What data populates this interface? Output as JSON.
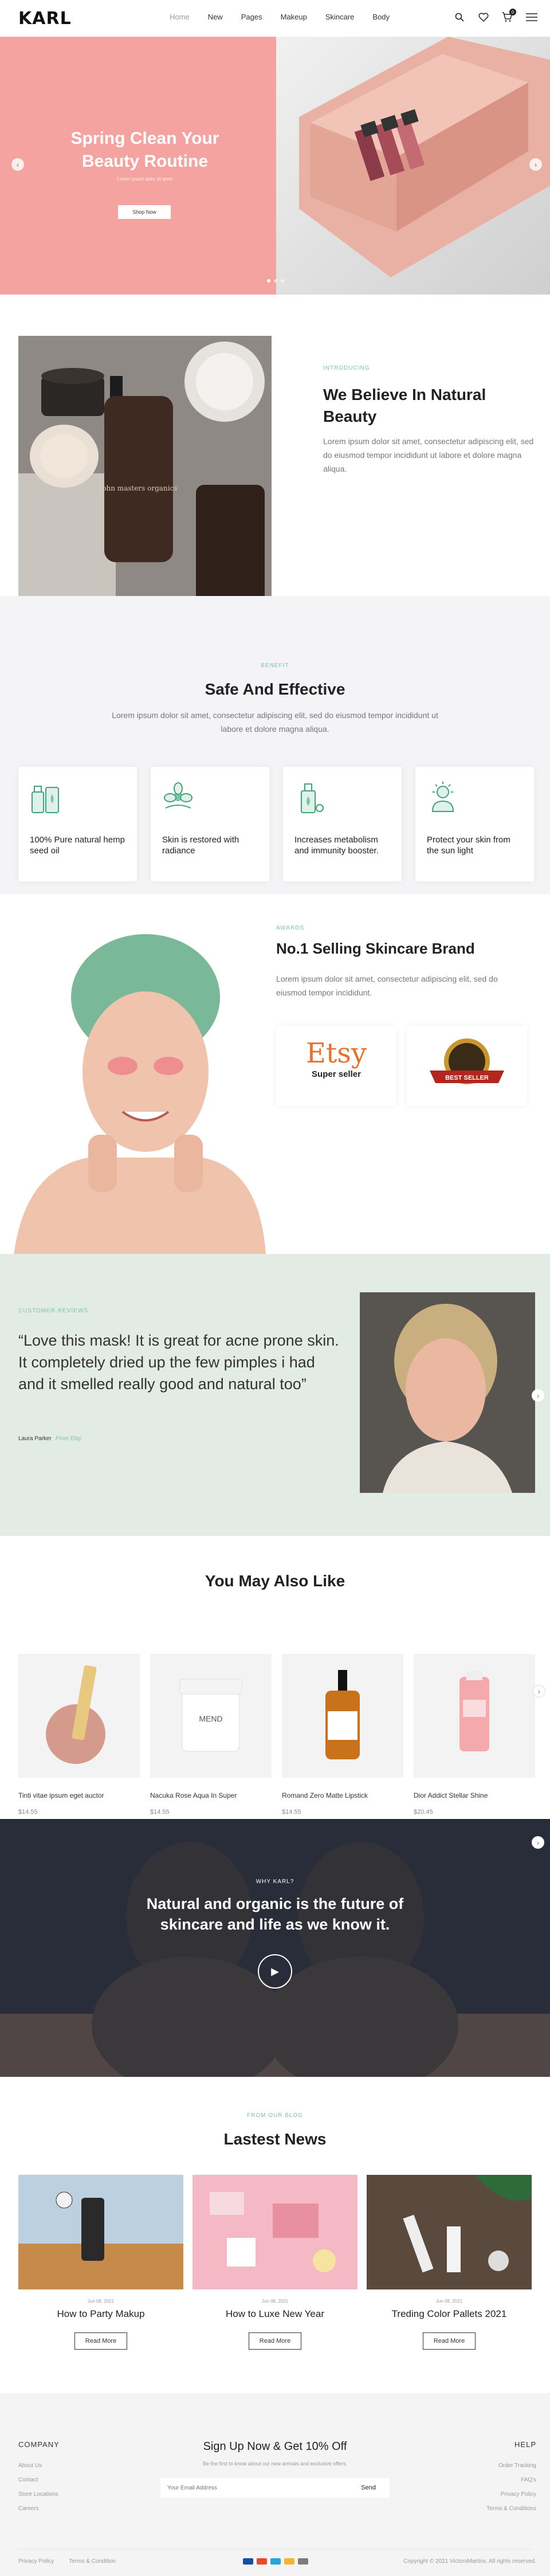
{
  "header": {
    "logo": "KARL",
    "nav": [
      {
        "label": "Home"
      },
      {
        "label": "New"
      },
      {
        "label": "Pages"
      },
      {
        "label": "Makeup"
      },
      {
        "label": "Skincare"
      },
      {
        "label": "Body"
      }
    ],
    "cart_count": "0"
  },
  "hero": {
    "title": "Spring Clean Your Beauty Routine",
    "subtitle": "Lorem ipsum dolor sit amet",
    "button": "Shop Now"
  },
  "intro": {
    "tag": "INTRODUCING",
    "title": "We Believe In Natural Beauty",
    "text": "Lorem ipsum dolor sit amet, consectetur adipiscing elit, sed do eiusmod tempor incididunt ut labore et dolore magna aliqua.",
    "bottle_label": "john masters organics"
  },
  "benefit": {
    "tag": "BENEFIT",
    "title": "Safe And Effective",
    "text": "Lorem ipsum dolor sit amet, consectetur adipiscing elit, sed do eiusmod tempor incididunt ut labore et dolore magna aliqua.",
    "cards": [
      {
        "label": "100% Pure natural hemp seed oil"
      },
      {
        "label": "Skin is restored with radiance"
      },
      {
        "label": "Increases metabolism and immunity booster."
      },
      {
        "label": "Protect your skin from the sun light"
      }
    ]
  },
  "awards": {
    "tag": "AWARDS",
    "title": "No.1 Selling Skincare Brand",
    "text": "Lorem ipsum dolor sit amet, consectetur adipiscing elit, sed do eiusmod tempor incididunt.",
    "etsy": "Etsy",
    "etsy_sub": "Super seller",
    "amazon": "BEST SELLER"
  },
  "review": {
    "tag": "CUSTOMER REVIEWS",
    "quote": "“Love this mask! It is great for acne prone skin. It completely dried up the few pimples i had and it smelled really good and natural too”",
    "author": "Laura Parker",
    "source": "From Etsy"
  },
  "products": {
    "title": "You May Also Like",
    "items": [
      {
        "name": "Tinti vitae ipsum eget auctor",
        "price": "$14.55"
      },
      {
        "name": "Nacuka Rose Aqua In Super",
        "price": "$14.55"
      },
      {
        "name": "Romand Zero Matte Lipstick",
        "price": "$14.55"
      },
      {
        "name": "Dior Addict Stellar Shine",
        "price": "$20.45"
      }
    ]
  },
  "why": {
    "tag": "WHY KARL?",
    "title": "Natural and organic is the future of skincare and life as we know it."
  },
  "blog": {
    "tag": "FROM OUR BLOG",
    "title": "Lastest News",
    "posts": [
      {
        "date": "Jun 08, 2021",
        "title": "How to Party Makup",
        "button": "Read More"
      },
      {
        "date": "Jun 08, 2021",
        "title": "How to Luxe New Year",
        "button": "Read More"
      },
      {
        "date": "Jun 08, 2021",
        "title": "Treding Color Pallets 2021",
        "button": "Read More"
      }
    ]
  },
  "footer": {
    "company": {
      "title": "COMPANY",
      "links": [
        "About Us",
        "Contact",
        "Store Locations",
        "Careers"
      ]
    },
    "signup": {
      "title": "Sign Up Now & Get 10% Off",
      "text": "Be the first to know about our new arrivals and exclusive offers.",
      "placeholder": "Your Email Address",
      "button": "Send"
    },
    "help": {
      "title": "HELP",
      "links": [
        "Order Tracking",
        "FAQ's",
        "Privacy Policy",
        "Terms & Conditions"
      ]
    },
    "bottom_links": [
      "Privacy Policy",
      "Terms & Condition"
    ],
    "copyright": "Copyright © 2021 VictorsMartins. All rights reserved."
  },
  "colors": {
    "pink": "#f4a3a0",
    "mint": "#7cc4a3",
    "review_bg": "#e3ebe5",
    "dark": "#2e3340"
  }
}
